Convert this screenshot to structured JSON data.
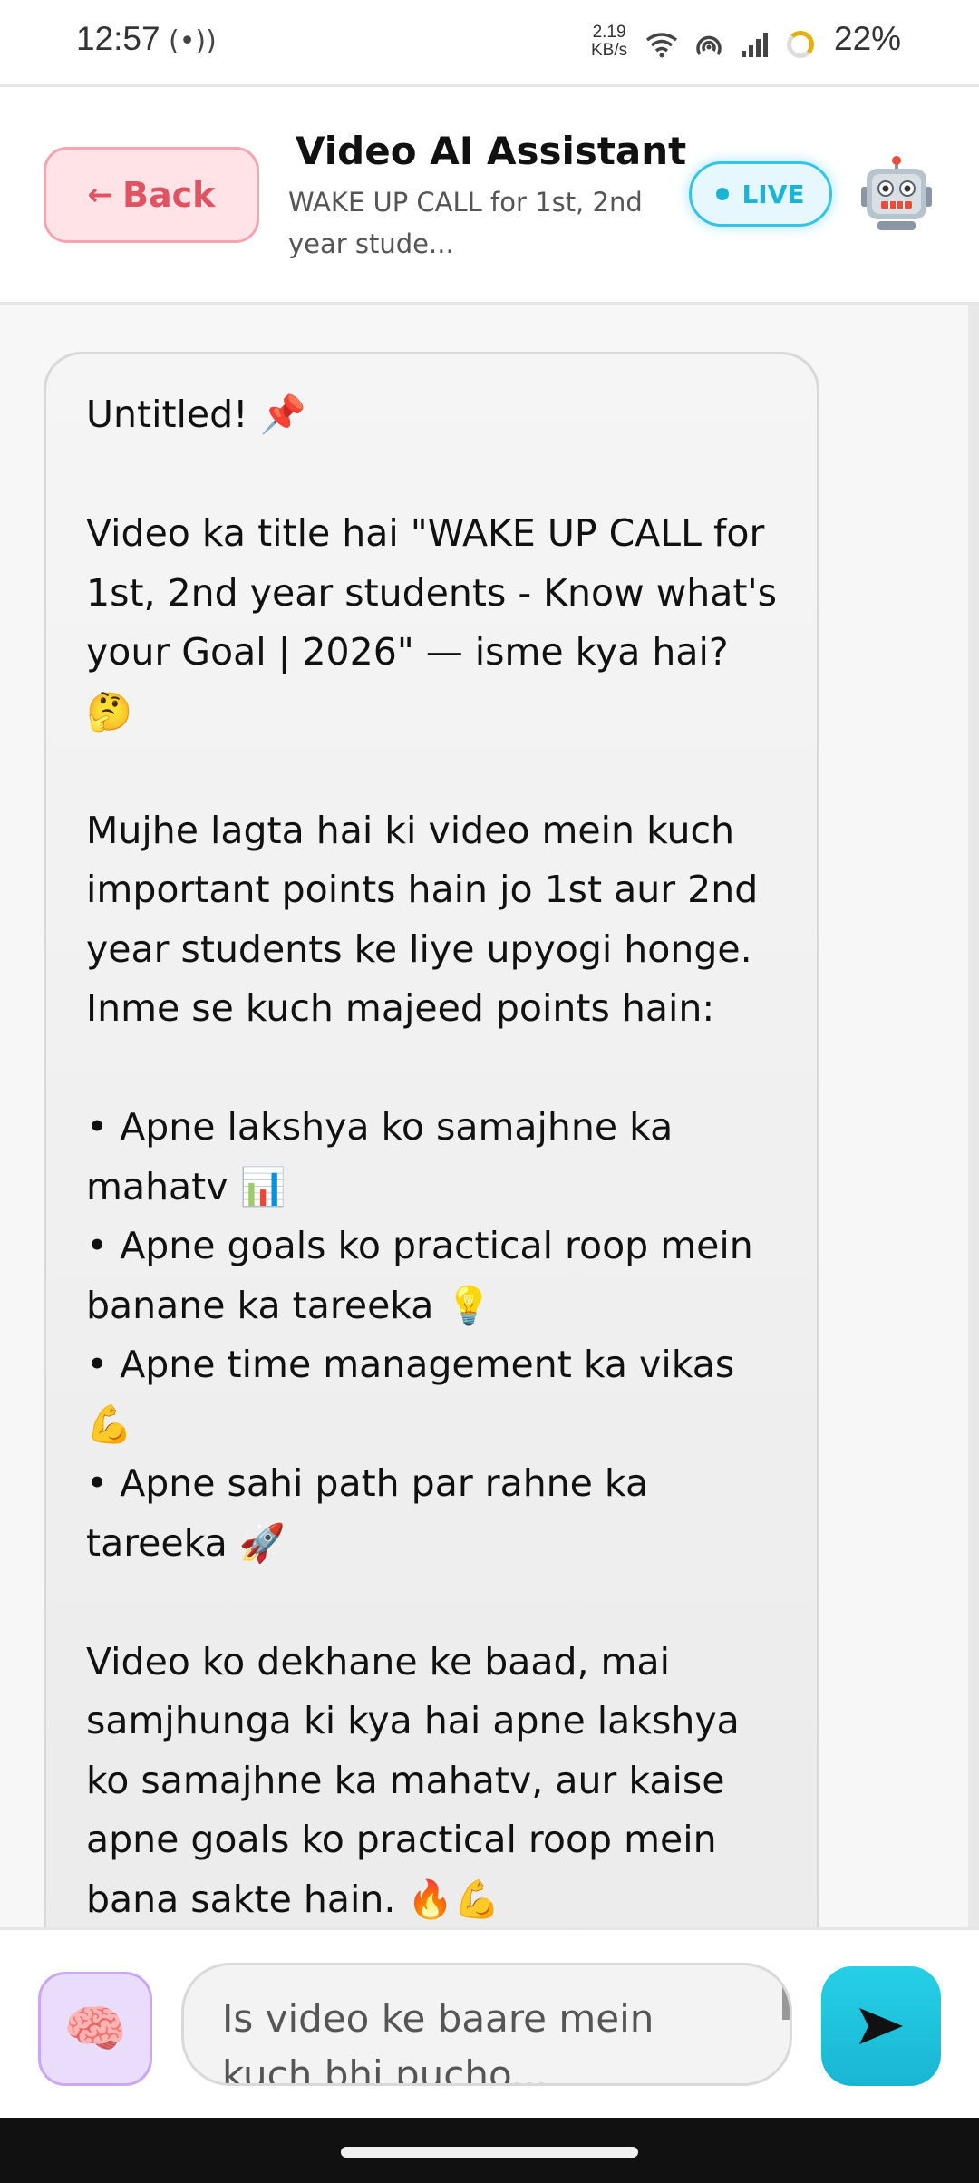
{
  "status_bar": {
    "time": "12:57",
    "radio_glyph": "(•))",
    "speed_value": "2.19",
    "speed_unit": "KB/s",
    "battery": "22%",
    "icons": [
      "radio-icon",
      "wifi-icon",
      "hotspot-icon",
      "signal-icon",
      "battery-ring-icon"
    ]
  },
  "header": {
    "back_arrow": "←",
    "back_label": "Back",
    "title": "Video AI Assistant",
    "subtitle": "WAKE UP CALL for 1st, 2nd year stude...",
    "live_label": "LIVE",
    "live_color": "#1bb4d6",
    "back_color": "#e05363"
  },
  "message": {
    "lines": [
      "Untitled! 📌",
      "",
      "Video ka title hai \"WAKE UP CALL for",
      "1st, 2nd year students - Know what's",
      "your Goal | 2026\" — isme kya hai? 🤔",
      "",
      "Mujhe lagta hai ki video mein kuch",
      "important points hain jo 1st aur 2nd",
      "year students ke liye upyogi honge.",
      "Inme se kuch majeed points hain:",
      "",
      "• Apne lakshya ko samajhne ka",
      "mahatv 📊",
      "• Apne goals ko practical roop mein",
      "banane ka tareeka 💡",
      "• Apne time management ka vikas",
      "💪",
      "• Apne sahi path par rahne ka",
      "tareeka 🚀",
      "",
      "Video ko dekhane ke baad, mai",
      "samjhunga ki kya hai apne lakshya",
      "ko samajhne ka mahatv, aur kaise",
      "apne goals ko practical roop mein",
      "bana sakte hain. 🔥💪"
    ]
  },
  "input": {
    "brain_glyph": "🧠",
    "placeholder": "Is video ke baare mein kuch bhi pucho...",
    "accent_color": "#19b6d3"
  }
}
